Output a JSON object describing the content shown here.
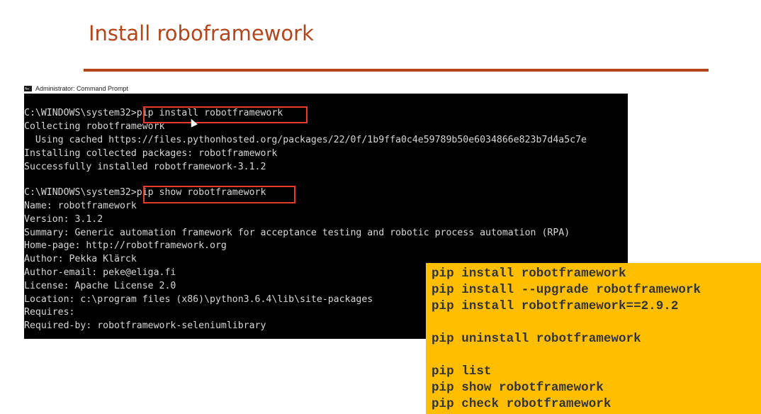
{
  "slide": {
    "title": "Install roboframework"
  },
  "window": {
    "title": "Administrator: Command Prompt"
  },
  "console": {
    "lines": [
      "",
      "C:\\WINDOWS\\system32>pip install robotframework",
      "Collecting robotframework",
      "  Using cached https://files.pythonhosted.org/packages/22/0f/1b9ffa0c4e59789b50e6034866e823b7d4a5c7e",
      "Installing collected packages: robotframework",
      "Successfully installed robotframework-3.1.2",
      "",
      "C:\\WINDOWS\\system32>pip show robotframework",
      "Name: robotframework",
      "Version: 3.1.2",
      "Summary: Generic automation framework for acceptance testing and robotic process automation (RPA)",
      "Home-page: http://robotframework.org",
      "Author: Pekka Klärck",
      "Author-email: peke@eliga.fi",
      "License: Apache License 2.0",
      "Location: c:\\program files (x86)\\python3.6.4\\lib\\site-packages",
      "Requires:",
      "Required-by: robotframework-seleniumlibrary"
    ]
  },
  "notes": {
    "lines": [
      "pip install robotframework",
      "pip install --upgrade robotframework",
      "pip install robotframework==2.9.2",
      "",
      "pip uninstall robotframework",
      "",
      "pip list",
      "pip show robotframework",
      "pip check robotframework"
    ]
  },
  "colors": {
    "accent": "#b5451b",
    "highlight": "#e83a2c",
    "note_bg": "#ffbf00",
    "console_bg": "#000000"
  },
  "icons": {
    "window": "cmd-icon",
    "pointer": "cursor-arrow-icon"
  }
}
